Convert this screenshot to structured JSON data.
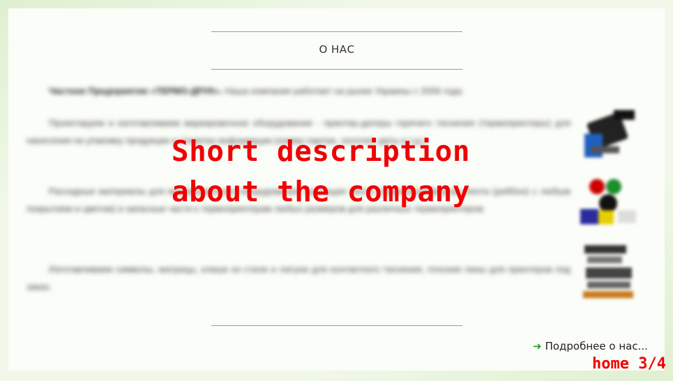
{
  "section": {
    "title": "О НАС"
  },
  "content": {
    "intro_bold": "Частное Предприятие «ТЕРМО-ДРУК».",
    "intro_text": "Наша компания работает на рынке Украины с 2006 года.",
    "paragraph_2": "Проектируем и изготавливаем маркировочное оборудование - принтер-датеры горячего тиснения (термопринтеры) для нанесения на упаковку продукции и этикетки информации (номер партии, логотип, даты и т.д.).",
    "paragraph_3": "Расходные материалы для маркировочного оборудования: красящая лента (термотрансферная лента (риббон) с любым покрытием и цветом) и запасные части к термопринтерам любых размеров для различных термопринтеров.",
    "paragraph_4": "Изготавливаем символы, матрицы, клише из стали и латуни для контактного тиснения, плоские пины для принтеров под заказ."
  },
  "overlay": {
    "line1": "Short description",
    "line2": "about the company"
  },
  "link": {
    "more_label": "Подробнее о нас..."
  },
  "page_tag": {
    "label": "home 3/4"
  },
  "colors": {
    "accent_red": "#f00000",
    "link_arrow": "#2f9c31"
  },
  "icons": {
    "more_link_arrow": "arrow-right-icon"
  }
}
